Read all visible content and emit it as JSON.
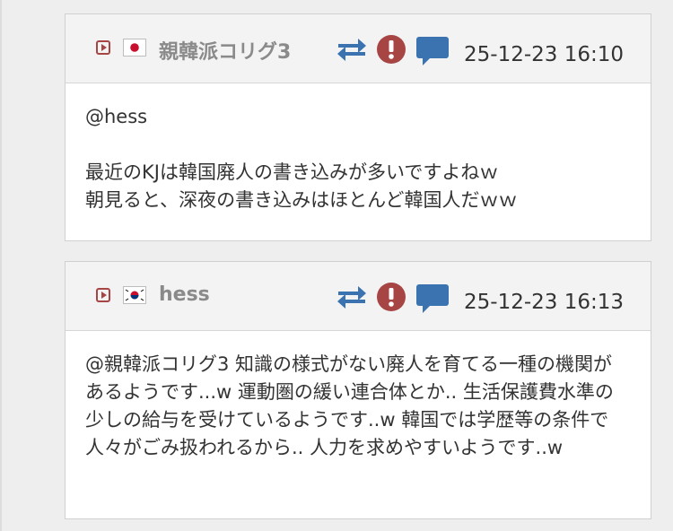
{
  "posts": [
    {
      "username": "親韓派コリグ3",
      "flag_icon": "japan-flag-icon",
      "timestamp": "25-12-23 16:10",
      "body": "@hess\n\n最近のKJは韓国廃人の書き込みが多いですよねｗ\n朝見ると、深夜の書き込みはほとんど韓国人だｗｗ"
    },
    {
      "username": "hess",
      "flag_icon": "korea-flag-icon",
      "timestamp": "25-12-23 16:13",
      "body": "@親韓派コリグ3 知識の様式がない廃人を育てる一種の機関があるようです...w 運動圏の緩い連合体とか.. 生活保護費水準の少しの給与を受けているようです..w 韓国では学歴等の条件で人々がごみ扱われるから.. 人力を求めやすいようです..w"
    }
  ],
  "icons": {
    "play": "play-icon",
    "translate": "translate-arrows-icon",
    "report": "report-exclamation-icon",
    "reply": "comment-icon"
  },
  "colors": {
    "icon_red": "#a74545",
    "icon_blue": "#3b73b1",
    "header_bg": "#f3f3f3",
    "username": "#8a8a8a"
  }
}
